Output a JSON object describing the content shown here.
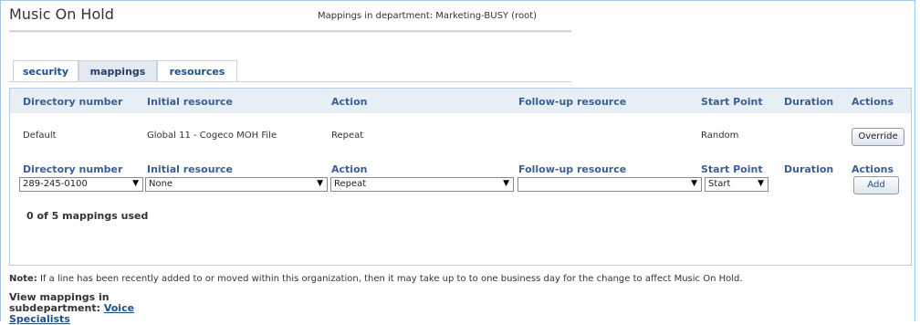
{
  "app": {
    "title": "Music On Hold",
    "mapping_department": "Mappings in department: Marketing-BUSY (root)"
  },
  "tabs": [
    {
      "label": "security",
      "active": false
    },
    {
      "label": "mappings",
      "active": true
    },
    {
      "label": "resources",
      "active": false
    }
  ],
  "table": {
    "headers": {
      "directory_number": "Directory number",
      "initial_resource": "Initial resource",
      "action": "Action",
      "followup_resource": "Follow-up resource",
      "start_point": "Start Point",
      "duration": "Duration",
      "actions": "Actions"
    },
    "default_row": {
      "directory_number": "Default",
      "initial_resource": "Global 11 - Cogeco MOH File",
      "action": "Repeat",
      "followup_resource": "",
      "start_point": "Random",
      "duration": "",
      "override_label": "Override"
    },
    "new_row": {
      "directory_number": "289-245-0100",
      "initial_resource": "None",
      "action": "Repeat",
      "followup_resource": "",
      "start_point": "Start",
      "add_label": "Add"
    },
    "usage": "0 of 5 mappings used"
  },
  "note": {
    "label": "Note:",
    "text": "If a line has been recently added to or moved within this organization, then it may take up to to one business day for the change to affect Music On Hold."
  },
  "view": {
    "prefix": "View mappings in",
    "line2": "subdepartment:",
    "link_part1": "Voice",
    "link_part2": "Specialists"
  },
  "colors": {
    "header_text": "#3a5f96",
    "header_bar": "#e8eef5",
    "border": "#b8cde0"
  }
}
